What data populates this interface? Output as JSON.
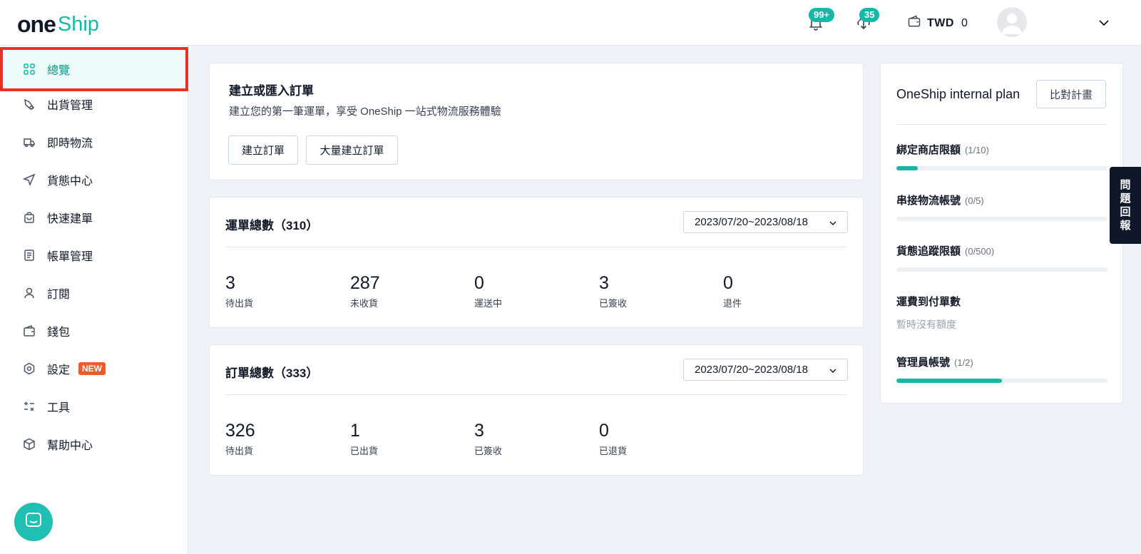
{
  "header": {
    "logo_one": "one",
    "logo_ship": "Ship",
    "notifications_badge": "99+",
    "downloads_badge": "35",
    "wallet_currency": "TWD",
    "wallet_amount": "0",
    "accent_color": "#14b8a6"
  },
  "sidebar": {
    "items": [
      {
        "label": "總覽",
        "icon": "grid-icon"
      },
      {
        "label": "出貨管理",
        "icon": "shipping-icon"
      },
      {
        "label": "即時物流",
        "icon": "truck-icon"
      },
      {
        "label": "貨態中心",
        "icon": "send-icon"
      },
      {
        "label": "快速建單",
        "icon": "bag-icon"
      },
      {
        "label": "帳單管理",
        "icon": "receipt-icon"
      },
      {
        "label": "訂閱",
        "icon": "user-icon"
      },
      {
        "label": "錢包",
        "icon": "wallet-icon"
      },
      {
        "label": "設定",
        "icon": "settings-icon",
        "badge": "NEW"
      },
      {
        "label": "工具",
        "icon": "tools-icon"
      },
      {
        "label": "幫助中心",
        "icon": "box-icon"
      }
    ]
  },
  "create": {
    "title": "建立或匯入訂單",
    "subtitle": "建立您的第一筆運單，享受 OneShip 一站式物流服務體驗",
    "create_button": "建立訂單",
    "bulk_button": "大量建立訂單"
  },
  "waybills": {
    "title": "運單總數（310）",
    "date_range": "2023/07/20~2023/08/18",
    "stats": [
      {
        "value": "3",
        "label": "待出貨"
      },
      {
        "value": "287",
        "label": "未收貨"
      },
      {
        "value": "0",
        "label": "運送中"
      },
      {
        "value": "3",
        "label": "已簽收"
      },
      {
        "value": "0",
        "label": "退件"
      }
    ]
  },
  "orders": {
    "title": "訂單總數（333）",
    "date_range": "2023/07/20~2023/08/18",
    "stats": [
      {
        "value": "326",
        "label": "待出貨"
      },
      {
        "value": "1",
        "label": "已出貨"
      },
      {
        "value": "3",
        "label": "已簽收"
      },
      {
        "value": "0",
        "label": "已退貨"
      }
    ]
  },
  "plan": {
    "title": "OneShip internal plan",
    "compare_button": "比對計畫",
    "limits": [
      {
        "name": "綁定商店限額",
        "count": "(1/10)",
        "fraction": 0.1
      },
      {
        "name": "串接物流帳號",
        "count": "(0/5)",
        "fraction": 0
      },
      {
        "name": "貨態追蹤限額",
        "count": "(0/500)",
        "fraction": 0
      },
      {
        "name": "運費到付單數",
        "note": "暫時沒有額度"
      },
      {
        "name": "管理員帳號",
        "count": "(1/2)",
        "fraction": 0.5
      }
    ]
  },
  "feedback": {
    "chars": [
      "問",
      "題",
      "回",
      "報"
    ]
  }
}
